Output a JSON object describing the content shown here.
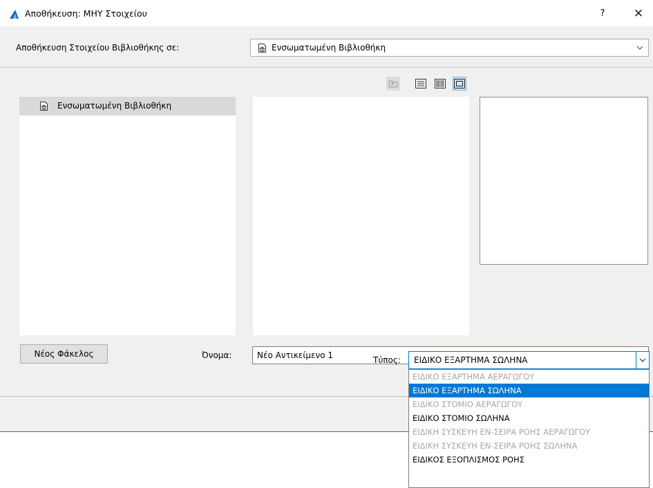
{
  "window": {
    "title": "Αποθήκευση: ΜΗΥ Στοιχείου",
    "help_label": "?",
    "close_label": "✕",
    "app_icon": "archicad-logo-icon"
  },
  "save_in": {
    "label": "Αποθήκευση Στοιχείου Βιβλιοθήκης σε:",
    "value": "Ενσωματωμένη Βιβλιοθήκη",
    "icon": "library-icon"
  },
  "toolbar": {
    "buttons": [
      "folder-up-icon",
      "list-view-icon",
      "grid-view-icon",
      "preview-view-icon"
    ],
    "active": "preview-view-icon"
  },
  "folder_tree": {
    "items": [
      {
        "label": "Ενσωματωμένη Βιβλιοθήκη",
        "icon": "library-icon",
        "selected": true
      }
    ]
  },
  "footer": {
    "new_folder_label": "Νέος Φάκελος",
    "name_label": "Όνομα:",
    "name_value": "Νέο Αντικείμενο 1",
    "type_label": "Τύπος:",
    "type_value": "ΕΙΔΙΚΟ ΕΞΑΡΤΗΜΑ ΣΩΛΗΝΑ"
  },
  "type_options": [
    {
      "label": "ΕΙΔΙΚΟ ΕΞΑΡΤΗΜΑ ΑΕΡΑΓΩΓΟΥ",
      "state": "disabled"
    },
    {
      "label": "ΕΙΔΙΚΟ ΕΞΑΡΤΗΜΑ ΣΩΛΗΝΑ",
      "state": "selected"
    },
    {
      "label": "ΕΙΔΙΚΟ ΣΤΟΜΙΟ ΑΕΡΑΓΩΓΟΥ",
      "state": "disabled"
    },
    {
      "label": "ΕΙΔΙΚΟ ΣΤΟΜΙΟ ΣΩΛΗΝΑ",
      "state": "enabled"
    },
    {
      "label": "ΕΙΔΙΚΗ ΣΥΣΚΕΥΗ ΕΝ-ΣΕΙΡΑ ΡΟΗΣ ΑΕΡΑΓΩΓΟΥ",
      "state": "disabled"
    },
    {
      "label": "ΕΙΔΙΚΗ ΣΥΣΚΕΥΗ ΕΝ-ΣΕΙΡΑ ΡΟΗΣ ΣΩΛΗΝΑ",
      "state": "disabled"
    },
    {
      "label": "ΕΙΔΙΚΟΣ ΕΞΟΠΛΙΣΜΟΣ ΡΟΗΣ",
      "state": "enabled"
    },
    {
      "label": "",
      "state": "enabled"
    }
  ],
  "colors": {
    "accent": "#0078d7",
    "disabled_text": "#a6a6a6",
    "dialog_bg": "#f0f0f0"
  }
}
